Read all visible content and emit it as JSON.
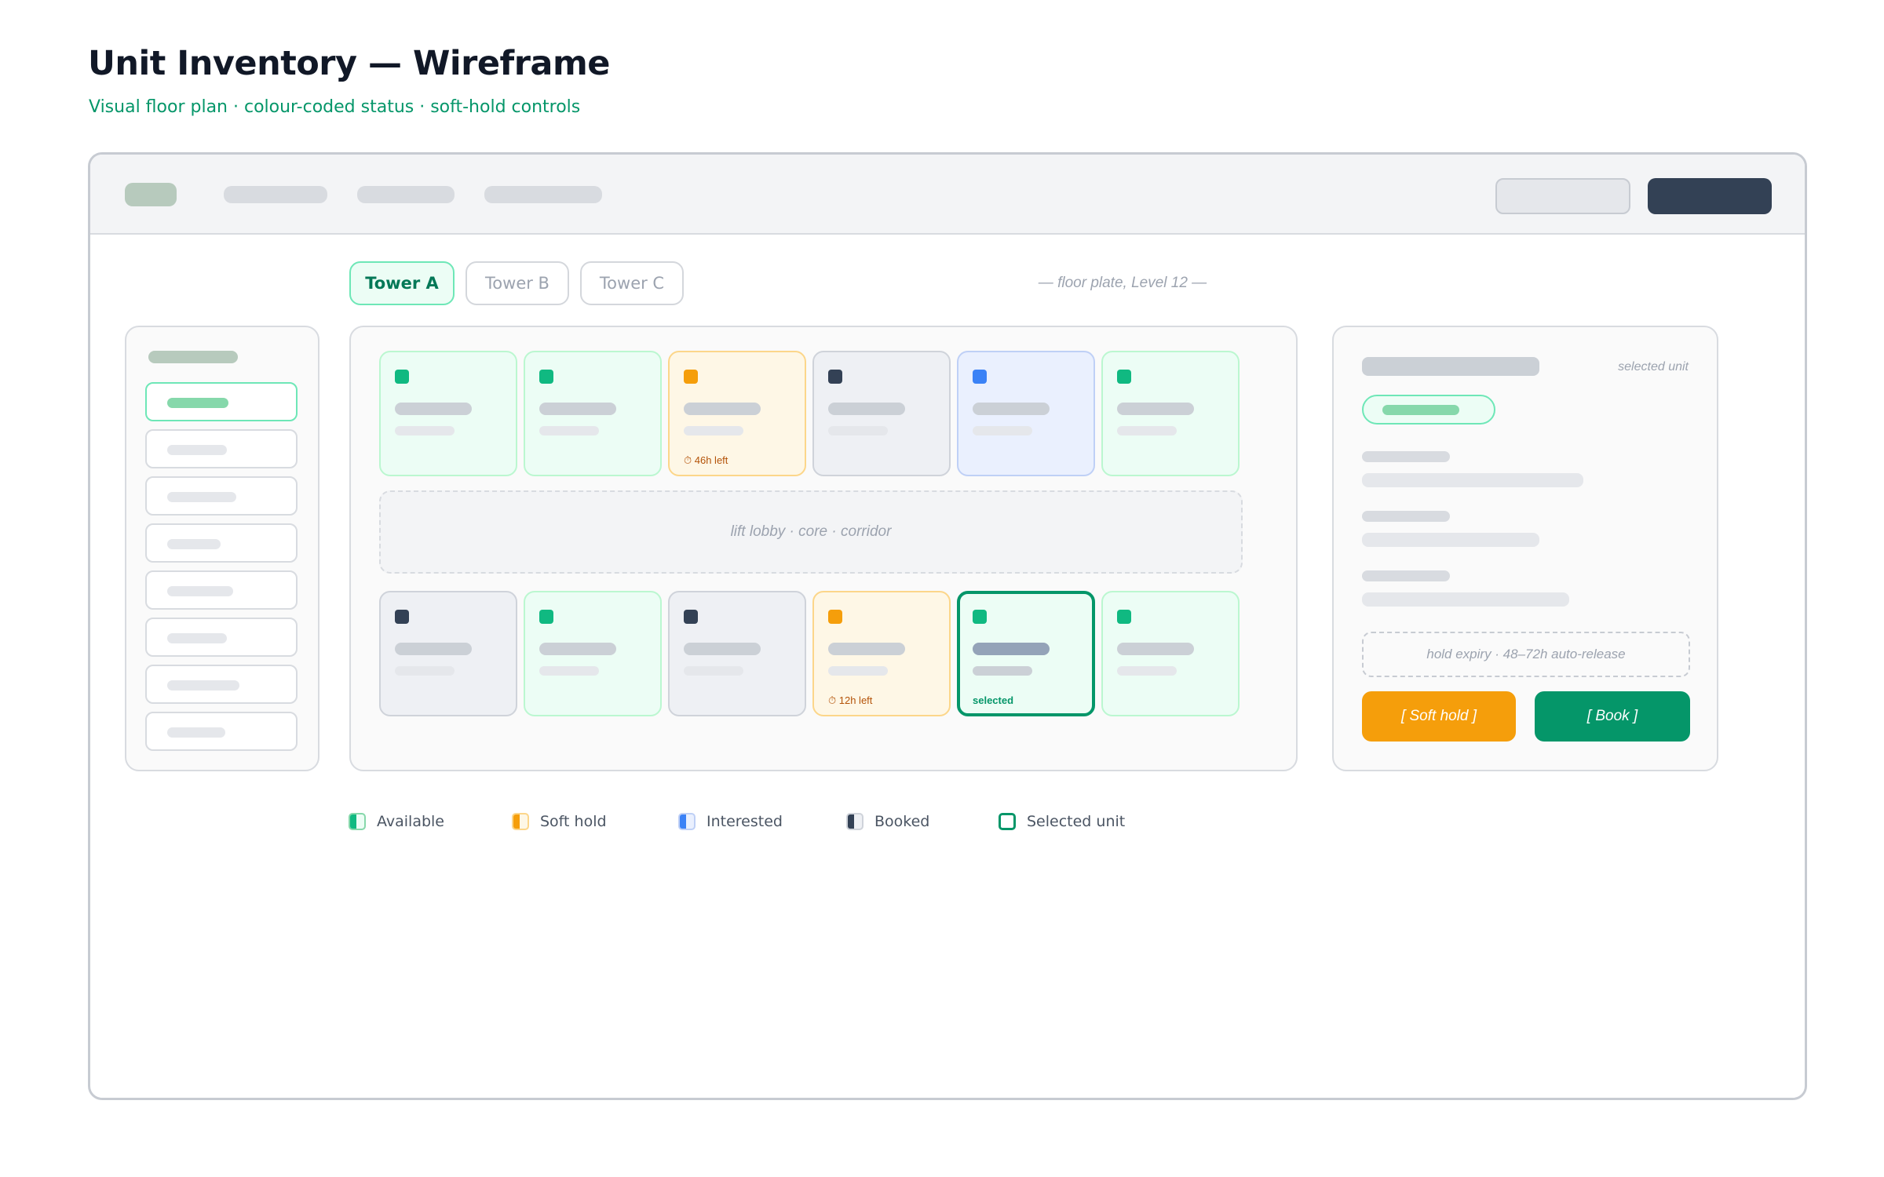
{
  "header": {
    "title": "Unit Inventory — Wireframe",
    "subtitle": "Visual floor plan · colour-coded status · soft-hold controls"
  },
  "towers": {
    "tabs": [
      "Tower A",
      "Tower B",
      "Tower C"
    ],
    "active": "Tower A",
    "floor_label": "— floor plate, Level 12 —"
  },
  "floor": {
    "lobby_label": "lift lobby · core · corridor",
    "top_row": [
      {
        "status": "available",
        "tag": ""
      },
      {
        "status": "available",
        "tag": ""
      },
      {
        "status": "hold",
        "tag": "⏱ 46h left"
      },
      {
        "status": "booked",
        "tag": ""
      },
      {
        "status": "interested",
        "tag": ""
      },
      {
        "status": "available",
        "tag": ""
      }
    ],
    "bottom_row": [
      {
        "status": "booked",
        "tag": ""
      },
      {
        "status": "available",
        "tag": ""
      },
      {
        "status": "booked",
        "tag": ""
      },
      {
        "status": "hold",
        "tag": "⏱ 12h left"
      },
      {
        "status": "selected",
        "tag": "selected"
      },
      {
        "status": "available",
        "tag": ""
      }
    ]
  },
  "detail": {
    "caption": "selected unit",
    "expiry_note": "hold expiry · 48–72h auto-release",
    "soft_hold_label": "[ Soft hold ]",
    "book_label": "[ Book ]"
  },
  "legend": [
    {
      "label": "Available",
      "fill": "#10b981",
      "border": "#86d8ab",
      "bg": "#ecfdf5"
    },
    {
      "label": "Soft hold",
      "fill": "#f59e0b",
      "border": "#fcd68a",
      "bg": "#fef7e6"
    },
    {
      "label": "Interested",
      "fill": "#3b82f6",
      "border": "#bfd0f6",
      "bg": "#eaf0fe"
    },
    {
      "label": "Booked",
      "fill": "#334155",
      "border": "#cfd3da",
      "bg": "#eef0f4"
    },
    {
      "label": "Selected unit",
      "fill": "",
      "border": "#059669",
      "bg": "#ffffff"
    }
  ],
  "colors": {
    "accent": "#059669",
    "available": "#10b981",
    "soft_hold": "#f59e0b",
    "interested": "#3b82f6",
    "booked": "#334155"
  }
}
